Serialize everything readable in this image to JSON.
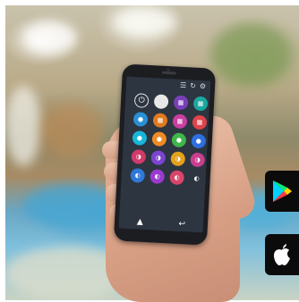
{
  "phone_app": {
    "topbar_icons": [
      "menu-icon",
      "refresh-icon",
      "settings-icon"
    ],
    "buttons": [
      {
        "name": "power",
        "glyph": "⏻",
        "color": "#2d3540"
      },
      {
        "name": "white",
        "glyph": "",
        "color": "#e8e8e8"
      },
      {
        "name": "purple-grid",
        "glyph": "▦",
        "color": "#7a3fb8"
      },
      {
        "name": "teal-grid",
        "glyph": "▦",
        "color": "#1aa8a0"
      },
      {
        "name": "blue-circle",
        "glyph": "●",
        "color": "#2a8fd6"
      },
      {
        "name": "orange-grid",
        "glyph": "▦",
        "color": "#e07a1f"
      },
      {
        "name": "magenta-grid",
        "glyph": "▦",
        "color": "#c93fa0"
      },
      {
        "name": "red-grid",
        "glyph": "▦",
        "color": "#e0434b"
      },
      {
        "name": "cyan-circle",
        "glyph": "●",
        "color": "#18b6d8"
      },
      {
        "name": "orange-circle",
        "glyph": "●",
        "color": "#f08a24"
      },
      {
        "name": "green-circle",
        "glyph": "●",
        "color": "#3fb54a"
      },
      {
        "name": "blue-circle-2",
        "glyph": "●",
        "color": "#2e6fe0"
      },
      {
        "name": "rainbow-1",
        "glyph": "◑",
        "color": "#d03b6a"
      },
      {
        "name": "rainbow-2",
        "glyph": "◑",
        "color": "#7a45d0"
      },
      {
        "name": "rainbow-3",
        "glyph": "◑",
        "color": "#e4a11c"
      },
      {
        "name": "rainbow-4",
        "glyph": "◑",
        "color": "#c83f8f"
      },
      {
        "name": "mode-1",
        "glyph": "◐",
        "color": "#2e78d8"
      },
      {
        "name": "mode-2",
        "glyph": "◐",
        "color": "#9a3bd0"
      },
      {
        "name": "mode-3",
        "glyph": "◐",
        "color": "#d8456a"
      },
      {
        "name": "mode-4",
        "glyph": "◐",
        "color": "#2d3540"
      }
    ],
    "bottom_icons": [
      "home-icon",
      "back-icon"
    ]
  },
  "badges": [
    "google-play-badge",
    "app-store-badge"
  ]
}
